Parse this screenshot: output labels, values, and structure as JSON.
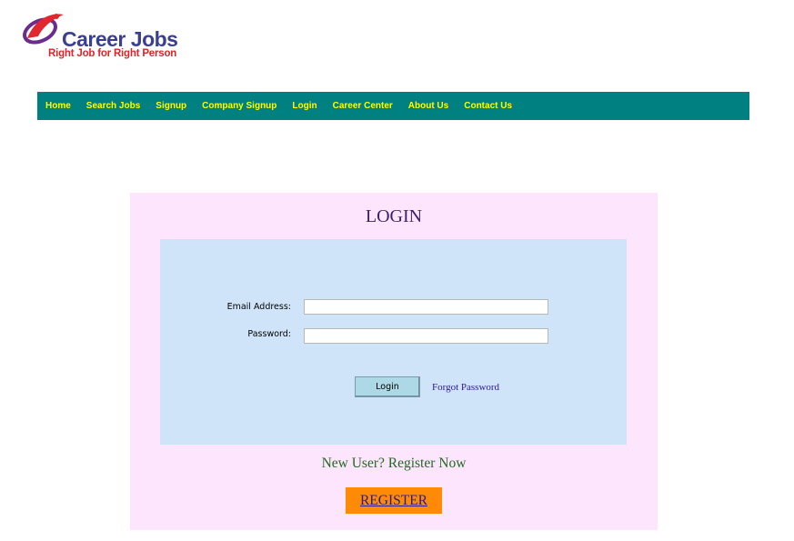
{
  "brand": {
    "name": "Career Jobs",
    "tagline": "Right Job for Right Person",
    "colors": {
      "name": "#3b3f93",
      "tagline": "#d9262b",
      "swoosh_red": "#e0262e",
      "swoosh_purple": "#6a2c8e"
    }
  },
  "nav": {
    "background": "#008080",
    "text_color": "#ffff00",
    "items": [
      {
        "label": "Home"
      },
      {
        "label": "Search Jobs"
      },
      {
        "label": "Signup"
      },
      {
        "label": "Company Signup"
      },
      {
        "label": "Login"
      },
      {
        "label": "Career Center"
      },
      {
        "label": "About Us"
      },
      {
        "label": "Contact Us"
      }
    ]
  },
  "login": {
    "title": "LOGIN",
    "email_label": "Email Address:",
    "email_value": "",
    "password_label": "Password:",
    "password_value": "",
    "submit_label": "Login",
    "forgot_label": "Forgot Password",
    "new_user_text": "New User? Register Now",
    "register_label": "REGISTER",
    "colors": {
      "panel": "#fde5fd",
      "form": "#cfe4f9",
      "button": "#add8e6",
      "register": "#ff8a05"
    }
  }
}
